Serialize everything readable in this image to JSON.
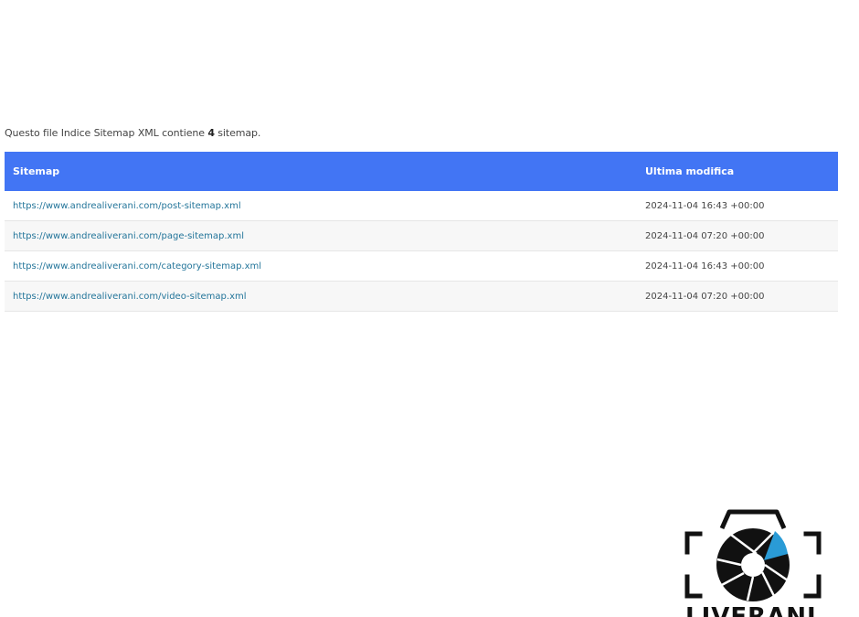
{
  "intro": {
    "prefix": "Questo file Indice Sitemap XML contiene ",
    "count": "4",
    "suffix": " sitemap."
  },
  "table": {
    "headers": {
      "sitemap": "Sitemap",
      "last_modified": "Ultima modifica"
    },
    "rows": [
      {
        "url": "https://www.andrealiverani.com/post-sitemap.xml",
        "date": "2024-11-04 16:43 +00:00"
      },
      {
        "url": "https://www.andrealiverani.com/page-sitemap.xml",
        "date": "2024-11-04 07:20 +00:00"
      },
      {
        "url": "https://www.andrealiverani.com/category-sitemap.xml",
        "date": "2024-11-04 16:43 +00:00"
      },
      {
        "url": "https://www.andrealiverani.com/video-sitemap.xml",
        "date": "2024-11-04 07:20 +00:00"
      }
    ]
  },
  "logo": {
    "icon": "camera-aperture-icon",
    "wordmark": "LIVERANI"
  },
  "colors": {
    "header_bg": "#4275f4",
    "link": "#23759a",
    "logo_accent": "#2a9bd6"
  }
}
